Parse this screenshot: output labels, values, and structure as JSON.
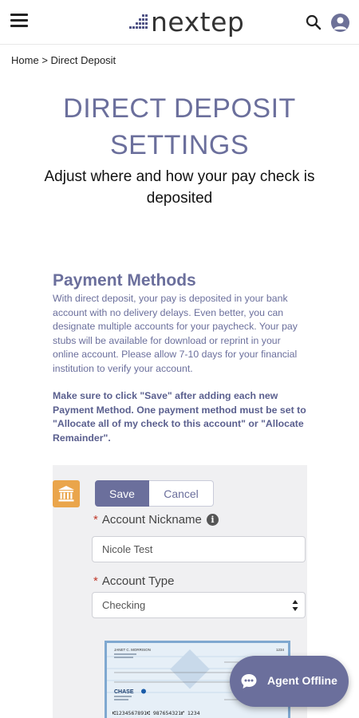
{
  "header": {
    "logo_text": "nextep"
  },
  "breadcrumb": {
    "home": "Home",
    "separator": ">",
    "current": "Direct Deposit"
  },
  "page": {
    "title_line1": "DIRECT DEPOSIT",
    "title_line2": "SETTINGS",
    "subtitle": "Adjust where and how your pay check is deposited"
  },
  "payment_methods": {
    "heading": "Payment Methods",
    "description": "With direct deposit, your pay is deposited in your bank account with no delivery delays. Even better, you can designate multiple accounts for your paycheck. Your pay stubs will be available for download or reprint in your online account. Please allow 7-10 days for your financial institution to verify your account.",
    "note": "Make sure to click \"Save\" after adding each new Payment Method. One payment method must be set to \"Allocate all of my check to this account\" or \"Allocate Remainder\"."
  },
  "form": {
    "save_label": "Save",
    "cancel_label": "Cancel",
    "nickname_label": "Account Nickname",
    "nickname_value": "Nicole Test",
    "account_type_label": "Account Type",
    "account_type_value": "Checking",
    "required_marker": "*",
    "info_glyph": "i"
  },
  "check": {
    "name": "JANET C. MORRISON",
    "number": "1234",
    "bank": "CHASE",
    "micr": "⑆1234567891⑆ 987654321⑈ 1234"
  },
  "chat": {
    "label": "Agent Offline"
  },
  "icons": {
    "menu": "hamburger-icon",
    "search": "search-icon",
    "user": "user-avatar-icon",
    "bank": "bank-icon",
    "info": "info-icon",
    "chat": "chat-bubble-icon"
  },
  "colors": {
    "brand": "#6b6f9c",
    "bank_badge": "#eaa54b",
    "required": "#c0392b"
  }
}
